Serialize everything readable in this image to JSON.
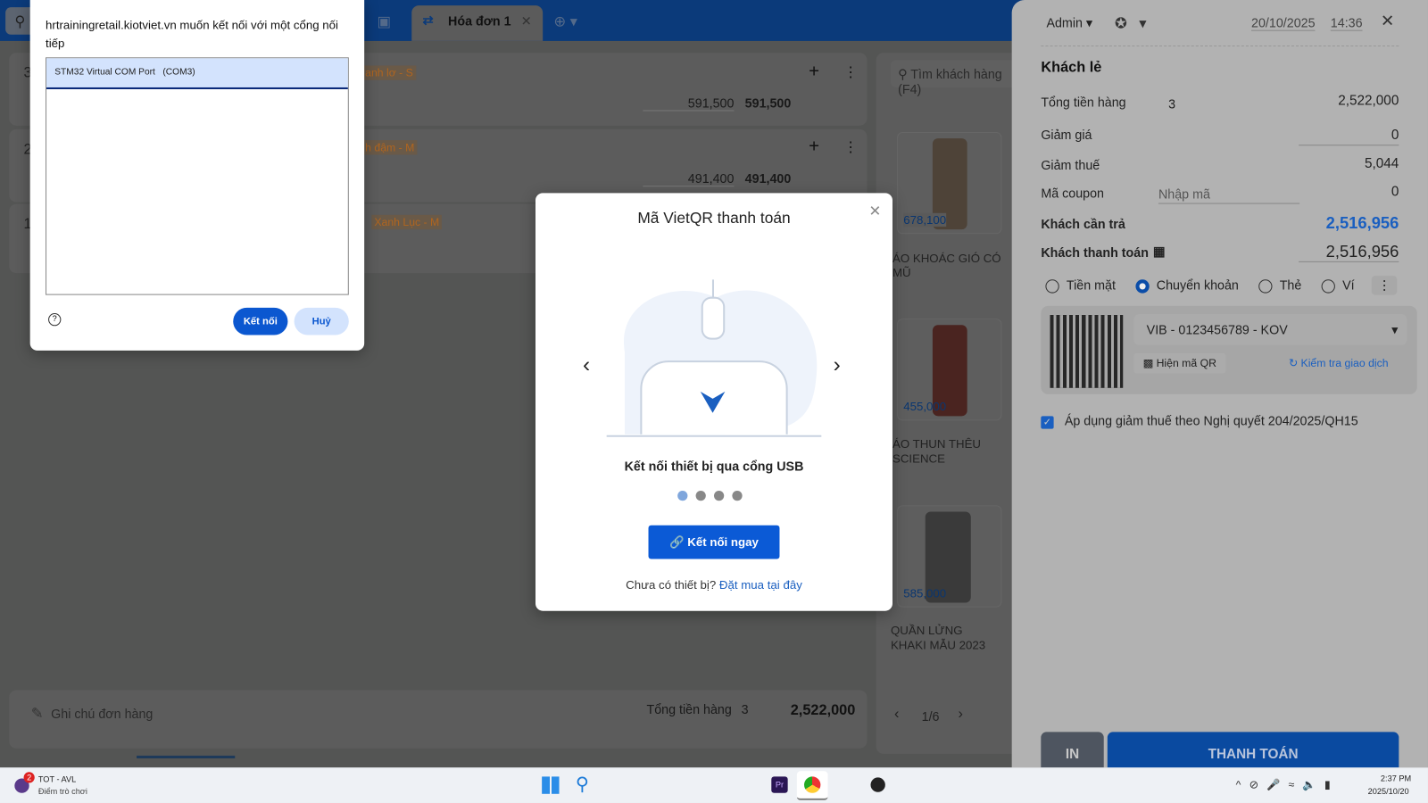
{
  "header": {
    "tab_label": "Hóa đơn 1",
    "search_placeholder": "Tìm khách hàng (F4)"
  },
  "order_lines": [
    {
      "index": "3",
      "variant": "anh lơ - S",
      "price": "591,500",
      "total": "591,500"
    },
    {
      "index": "2",
      "variant": "h đậm - M",
      "price": "491,400",
      "total": "491,400"
    },
    {
      "index": "1",
      "variant": "Xanh Lục - M"
    }
  ],
  "footer": {
    "note_placeholder": "Ghi chú đơn hàng",
    "total_label": "Tổng tiền hàng",
    "total_qty": "3",
    "total_value": "2,522,000"
  },
  "products": [
    {
      "name": "ÁO KHOÁC GIÓ CÓ MŨ",
      "price": "678,100"
    },
    {
      "name": "ÁO THUN THÊU SCIENCE",
      "price": "455,000"
    },
    {
      "name": "QUẦN LỬNG KHAKI MẪU 2023",
      "price": "585,000"
    }
  ],
  "pager": "1/6",
  "serial_dialog": {
    "title": "hrtrainingretail.kiotviet.vn muốn kết nối với một cổng nối tiếp",
    "ports": [
      "STM32 Virtual COM Port   (COM3)"
    ],
    "connect": "Kết nối",
    "cancel": "Huỷ"
  },
  "vietqr_modal": {
    "title": "Mã VietQR thanh toán",
    "caption": "Kết nối thiết bị qua cổng USB",
    "slides": 4,
    "active_slide": 1,
    "button": "Kết nối ngay",
    "footer_text": "Chưa có thiết bị?",
    "footer_link": "Đặt mua tại đây"
  },
  "drawer": {
    "user": "Admin",
    "date": "20/10/2025",
    "time": "14:36",
    "customer": "Khách lẻ",
    "subtotal_label": "Tổng tiền hàng",
    "subtotal_qty": "3",
    "subtotal": "2,522,000",
    "discount_label": "Giảm giá",
    "discount": "0",
    "tax_label": "Giảm thuế",
    "tax": "5,044",
    "coupon_label": "Mã coupon",
    "coupon_placeholder": "Nhập mã",
    "coupon_value": "0",
    "due_label": "Khách cần trả",
    "due": "2,516,956",
    "paid_label": "Khách thanh toán",
    "paid": "2,516,956",
    "methods": [
      "Tiền mặt",
      "Chuyển khoản",
      "Thẻ",
      "Ví"
    ],
    "selected_method": "Chuyển khoản",
    "bank_account": "VIB - 0123456789 - KOV",
    "show_qr": "Hiện mã QR",
    "check_tx": "Kiểm tra giao dịch",
    "tax_checkbox": "Áp dụng giảm thuế theo Nghị quyết 204/2025/QH15",
    "tax_checked": true,
    "print": "IN",
    "pay": "THANH TOÁN"
  },
  "taskbar": {
    "app_title": "TOT - AVL",
    "app_sub": "Điểm trò chơi",
    "badge": "2",
    "clock_time": "2:37 PM",
    "clock_date": "2025/10/20"
  },
  "colors": {
    "brand": "#0b4da8",
    "link": "#1565c0"
  }
}
